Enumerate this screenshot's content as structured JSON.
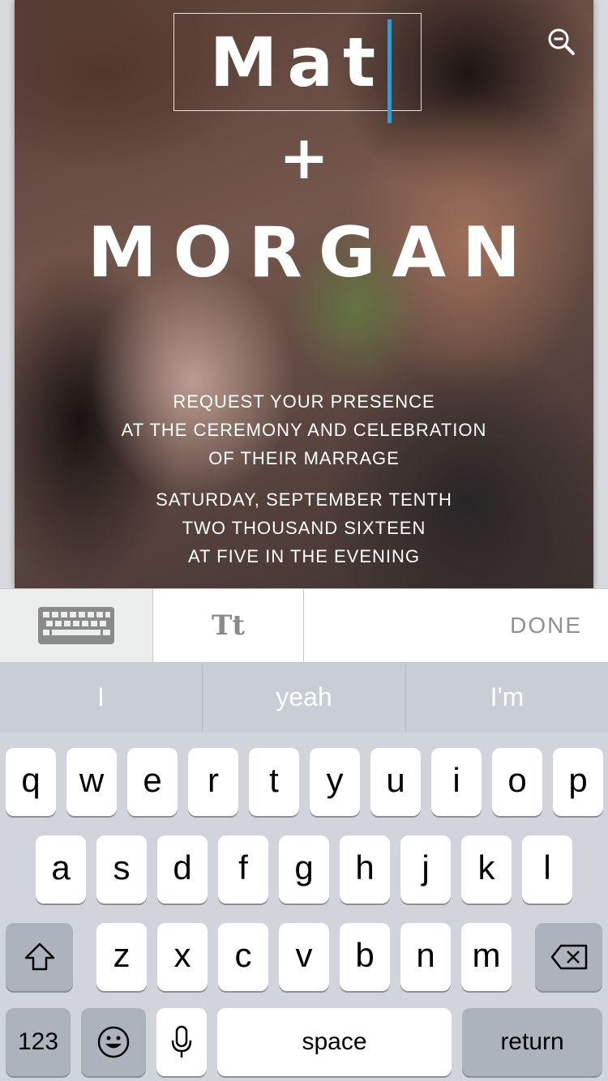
{
  "invitation": {
    "name_first": "Mat",
    "plus": "+",
    "name_second": "MORGAN",
    "lines_request": [
      "REQUEST YOUR PRESENCE",
      "AT THE CEREMONY AND CELEBRATION",
      "OF THEIR MARRAGE"
    ],
    "lines_date": [
      "SATURDAY, SEPTEMBER TENTH",
      "TWO THOUSAND SIXTEEN",
      "AT FIVE IN THE EVENING"
    ],
    "zoom_icon": "zoom-out-icon",
    "caret_color": "#2a9fdc"
  },
  "toolbar": {
    "keyboard_icon": "keyboard-icon",
    "text_style_label": "Tt",
    "done_label": "DONE"
  },
  "suggestions": [
    "I",
    "yeah",
    "I'm"
  ],
  "keyboard": {
    "row1": [
      "q",
      "w",
      "e",
      "r",
      "t",
      "y",
      "u",
      "i",
      "o",
      "p"
    ],
    "row2": [
      "a",
      "s",
      "d",
      "f",
      "g",
      "h",
      "j",
      "k",
      "l"
    ],
    "row3": [
      "z",
      "x",
      "c",
      "v",
      "b",
      "n",
      "m"
    ],
    "numbers_label": "123",
    "space_label": "space",
    "return_label": "return",
    "shift_icon": "shift-icon",
    "delete_icon": "backspace-icon",
    "emoji_icon": "emoji-icon",
    "mic_icon": "microphone-icon"
  }
}
